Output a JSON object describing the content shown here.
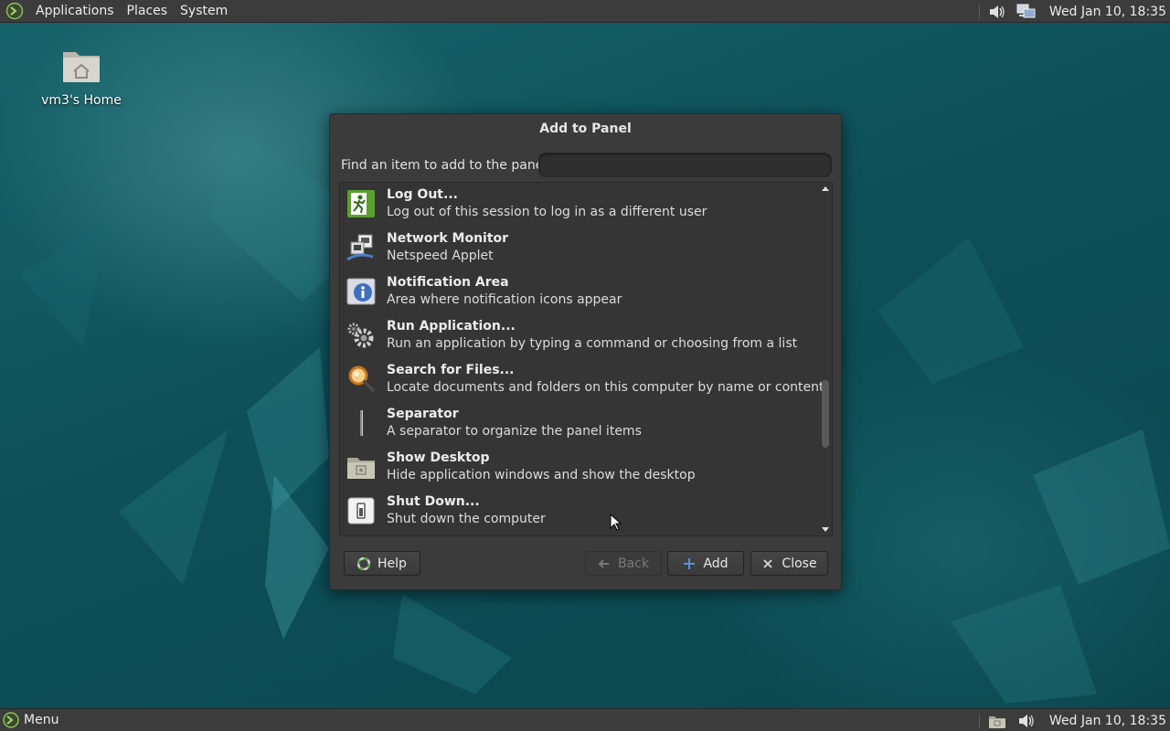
{
  "top_panel": {
    "menus": [
      "Applications",
      "Places",
      "System"
    ],
    "clock": "Wed Jan 10, 18:35"
  },
  "bottom_panel": {
    "menu_label": "Menu",
    "clock": "Wed Jan 10, 18:35"
  },
  "desktop": {
    "home_label": "vm3's Home"
  },
  "dialog": {
    "title": "Add to Panel",
    "find_label": "Find an item to add to the panel:",
    "search_value": "",
    "items": [
      {
        "title": "Log Out...",
        "desc": "Log out of this session to log in as a different user",
        "icon": "logout-icon"
      },
      {
        "title": "Network Monitor",
        "desc": "Netspeed Applet",
        "icon": "network-monitor-icon"
      },
      {
        "title": "Notification Area",
        "desc": "Area where notification icons appear",
        "icon": "notification-area-icon"
      },
      {
        "title": "Run Application...",
        "desc": "Run an application by typing a command or choosing from a list",
        "icon": "run-application-icon"
      },
      {
        "title": "Search for Files...",
        "desc": "Locate documents and folders on this computer by name or content",
        "icon": "search-files-icon"
      },
      {
        "title": "Separator",
        "desc": "A separator to organize the panel items",
        "icon": "separator-icon"
      },
      {
        "title": "Show Desktop",
        "desc": "Hide application windows and show the desktop",
        "icon": "show-desktop-icon"
      },
      {
        "title": "Shut Down...",
        "desc": "Shut down the computer",
        "icon": "shutdown-icon"
      }
    ],
    "buttons": {
      "help": "Help",
      "back": "Back",
      "add": "Add",
      "close": "Close"
    }
  },
  "colors": {
    "panel_bg": "#3c3c3c",
    "dialog_bg": "#3b3b3b",
    "list_bg": "#353535",
    "desktop_teal": "#0f4f57",
    "add_icon_blue": "#5b8fd6"
  }
}
